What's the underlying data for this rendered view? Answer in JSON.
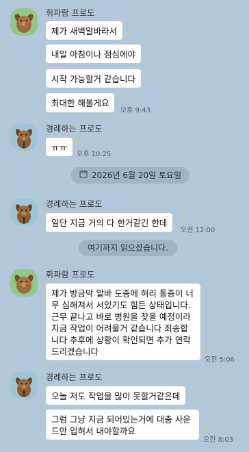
{
  "messages_group_1": {
    "sender": "휘파람 프로도",
    "bubbles": [
      {
        "text": "제가 새벽알바라서",
        "unread": "1",
        "time": ""
      },
      {
        "text": "내일 아침이나 점심에야",
        "unread": "1",
        "time": ""
      },
      {
        "text": "시작 가능할거 같습니다",
        "unread": "1",
        "time": ""
      },
      {
        "text": "최대한 해볼게요",
        "unread": "1",
        "time": "오후 9:43"
      }
    ]
  },
  "messages_group_2": {
    "sender": "경례하는 프로도",
    "bubbles": [
      {
        "text": "ㅠㅠ",
        "unread": "1",
        "time": "오후 10:25"
      }
    ]
  },
  "date_divider": {
    "label": "2026년 6월 20일 토요일"
  },
  "messages_group_3": {
    "sender": "경례하는 프로도",
    "bubbles": [
      {
        "text": "일단 지금 거의 다 한거같긴 한데",
        "unread": "1",
        "time": "오전 12:00"
      }
    ]
  },
  "read_marker": {
    "label": "여기까지 읽으셨습니다."
  },
  "messages_group_4": {
    "sender": "휘파람 프로도",
    "bubbles": [
      {
        "text": "제가 방금막 알바 도중에 허리 통증이 너무 심해져서 서있기도 힘든 상태입니다. 근무 끝나고 바로 병원을 찾을 예정이라 지금 작업이 어려울거 같습니다 죄송합니다 추후에 상황이 확인되면 추가 연락드리겠습니다",
        "unread": "1",
        "time": "오전 5:06"
      }
    ]
  },
  "messages_group_5": {
    "sender": "경례하는 프로도",
    "bubbles": [
      {
        "text": "오늘 저도 작업을 많이 못할거같은데",
        "unread": "2",
        "time": ""
      },
      {
        "text": "그럼 그냥 지금 되어있는거에 대충 사운드만 입혀서 내야할까요",
        "unread": "2",
        "time": "오전 8:03"
      }
    ]
  },
  "colors": {
    "background": "#b2c7da",
    "bubble": "#ffffff",
    "unread": "#e7c95a",
    "pill": "#a1b3c6"
  },
  "icons": {
    "avatar_whistle": "whistling-dog-avatar",
    "avatar_salute": "saluting-dog-avatar",
    "calendar": "calendar-icon"
  }
}
